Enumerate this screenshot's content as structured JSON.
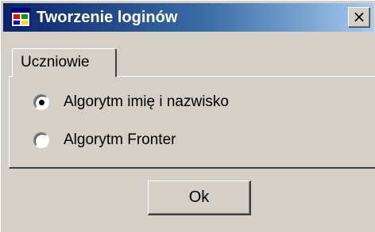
{
  "window": {
    "title": "Tworzenie loginów",
    "close_glyph": "×",
    "icon": "app-window-icon",
    "colors": {
      "titlebar_start": "#0a246a",
      "titlebar_end": "#a6caf0",
      "face": "#d4d0c8"
    }
  },
  "tabs": [
    {
      "label": "Uczniowie",
      "selected": true
    }
  ],
  "options": [
    {
      "label": "Algorytm imię i nazwisko",
      "checked": true
    },
    {
      "label": "Algorytm Fronter",
      "checked": false
    }
  ],
  "buttons": {
    "ok_label": "Ok"
  }
}
